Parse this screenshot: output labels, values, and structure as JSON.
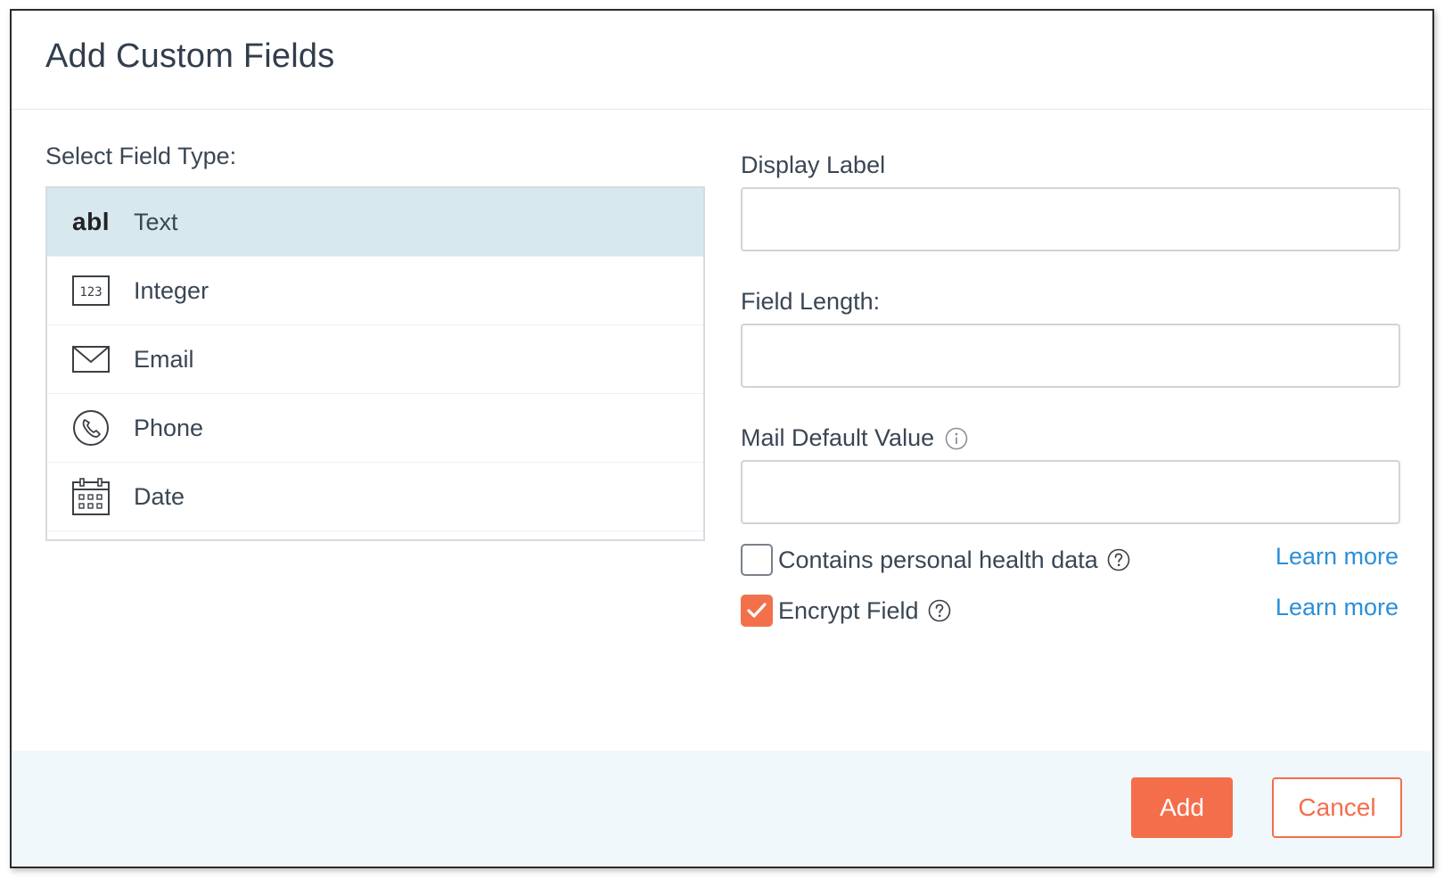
{
  "dialog": {
    "title": "Add Custom Fields"
  },
  "field_types": {
    "label": "Select Field Type:",
    "items": [
      {
        "label": "Text",
        "icon": "abl-text-icon",
        "glyph": "abl",
        "selected": true
      },
      {
        "label": "Integer",
        "icon": "number-123-icon",
        "selected": false
      },
      {
        "label": "Email",
        "icon": "envelope-icon",
        "selected": false
      },
      {
        "label": "Phone",
        "icon": "phone-icon",
        "selected": false
      },
      {
        "label": "Date",
        "icon": "calendar-icon",
        "selected": false
      }
    ]
  },
  "form": {
    "display_label": {
      "label": "Display Label",
      "value": "",
      "placeholder": ""
    },
    "field_length": {
      "label": "Field Length:",
      "value": "",
      "placeholder": ""
    },
    "mail_default": {
      "label": "Mail Default Value",
      "value": "",
      "placeholder": "",
      "info_icon": "info-icon"
    },
    "health_data": {
      "label": "Contains personal health data",
      "checked": false,
      "help_icon": "question-icon",
      "link": "Learn more"
    },
    "encrypt": {
      "label": "Encrypt Field",
      "checked": true,
      "help_icon": "question-icon",
      "link": "Learn more"
    }
  },
  "footer": {
    "add_label": "Add",
    "cancel_label": "Cancel"
  },
  "colors": {
    "accent": "#f46e4c",
    "link": "#2c8fd6",
    "selected_row": "#d7e8ef",
    "footer_bg": "#f1f8fc"
  }
}
